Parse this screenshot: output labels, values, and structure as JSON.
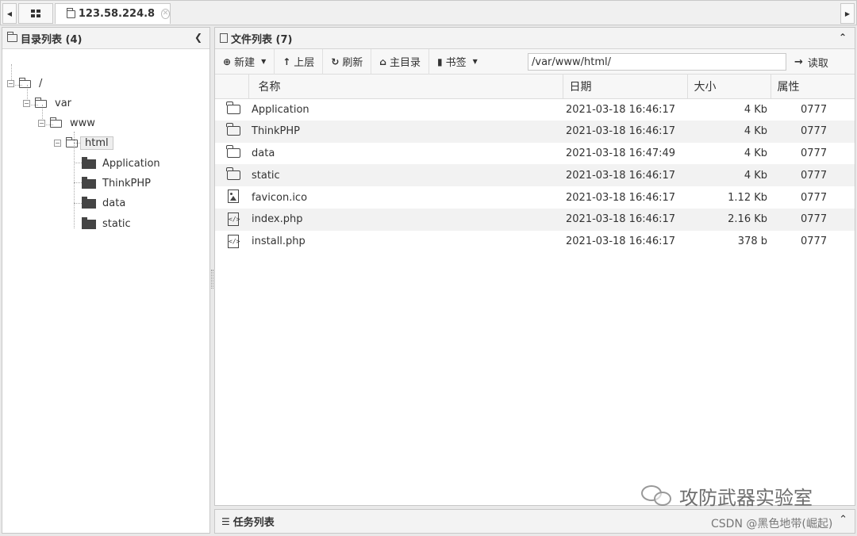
{
  "tabs": {
    "active_label": "123.58.224.8"
  },
  "left_panel": {
    "title": "目录列表 (4)",
    "tree": {
      "root": "/",
      "var": "var",
      "www": "www",
      "html": "html",
      "children": [
        "Application",
        "ThinkPHP",
        "data",
        "static"
      ]
    }
  },
  "right_panel": {
    "title": "文件列表 (7)",
    "toolbar": {
      "new_label": "新建",
      "up_label": "上层",
      "refresh_label": "刷新",
      "home_label": "主目录",
      "bookmark_label": "书签",
      "path_value": "/var/www/html/",
      "read_label": "读取"
    },
    "columns": {
      "name": "名称",
      "date": "日期",
      "size": "大小",
      "attr": "属性"
    },
    "rows": [
      {
        "icon": "folder-icon",
        "name": "Application",
        "date": "2021-03-18 16:46:17",
        "size": "4 Kb",
        "attr": "0777"
      },
      {
        "icon": "folder-icon",
        "name": "ThinkPHP",
        "date": "2021-03-18 16:46:17",
        "size": "4 Kb",
        "attr": "0777"
      },
      {
        "icon": "folder-icon",
        "name": "data",
        "date": "2021-03-18 16:47:49",
        "size": "4 Kb",
        "attr": "0777"
      },
      {
        "icon": "folder-icon",
        "name": "static",
        "date": "2021-03-18 16:46:17",
        "size": "4 Kb",
        "attr": "0777"
      },
      {
        "icon": "image-file-icon",
        "name": "favicon.ico",
        "date": "2021-03-18 16:46:17",
        "size": "1.12 Kb",
        "attr": "0777"
      },
      {
        "icon": "code-file-icon",
        "name": "index.php",
        "date": "2021-03-18 16:46:17",
        "size": "2.16 Kb",
        "attr": "0777"
      },
      {
        "icon": "code-file-icon",
        "name": "install.php",
        "date": "2021-03-18 16:46:17",
        "size": "378 b",
        "attr": "0777"
      }
    ]
  },
  "task_panel": {
    "title": "任务列表"
  },
  "watermarks": {
    "wechat": "攻防武器实验室",
    "csdn": "CSDN @黑色地带(崛起)"
  }
}
